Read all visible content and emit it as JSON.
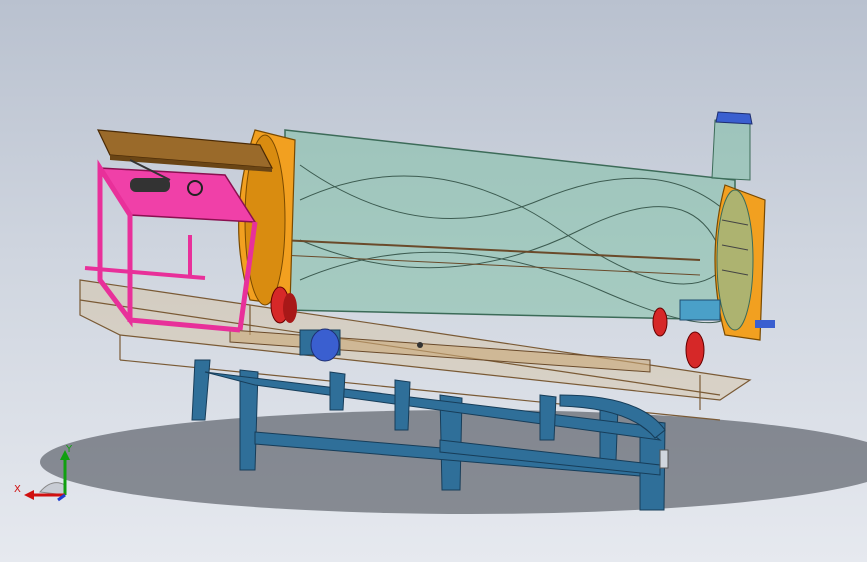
{
  "viewport": {
    "background_top": "#b9c1cf",
    "background_bottom": "#e6e9ef"
  },
  "colors": {
    "drum_glass": "#7fbfa6",
    "drum_edge": "#3c6b58",
    "end_ring": "#f2a020",
    "stand_blue": "#2f6f99",
    "stand_dark": "#1e4d6f",
    "motor_frame": "#e8309a",
    "motor_frame_fill": "#f040a8",
    "hopper_brown": "#9a6a2a",
    "base_frame": "#d8b98a",
    "pulley_red": "#d62828",
    "blue_part": "#3a5fd0",
    "shadow": "#3b3f48",
    "axis_x": "#d01010",
    "axis_y": "#10a010",
    "axis_z": "#1f3fd0"
  },
  "triad": {
    "x_label": "X",
    "y_label": "Y",
    "icon": "coordinate-triad-icon"
  }
}
